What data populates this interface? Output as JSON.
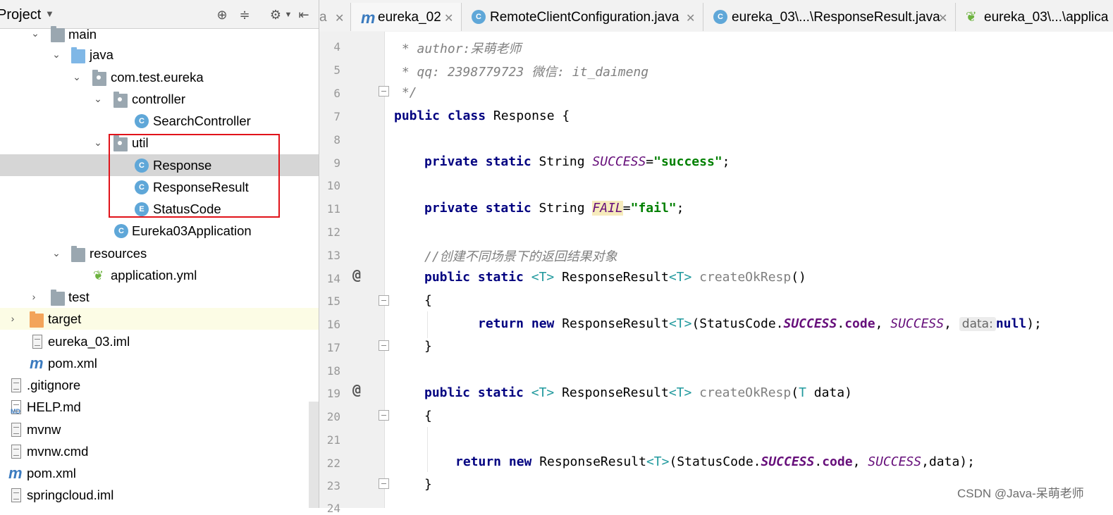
{
  "project_panel": {
    "title": "Project",
    "tree": [
      {
        "label": "main",
        "icon": "folder-icon",
        "indent": 1,
        "expanded": true
      },
      {
        "label": "java",
        "icon": "source-folder-icon",
        "indent": 2,
        "expanded": true
      },
      {
        "label": "com.test.eureka",
        "icon": "package-icon",
        "indent": 3,
        "expanded": true
      },
      {
        "label": "controller",
        "icon": "package-icon",
        "indent": 4,
        "expanded": true
      },
      {
        "label": "SearchController",
        "icon": "class-icon",
        "indent": 5
      },
      {
        "label": "util",
        "icon": "package-icon",
        "indent": 4,
        "expanded": true
      },
      {
        "label": "Response",
        "icon": "class-icon",
        "indent": 5,
        "selected": true
      },
      {
        "label": "ResponseResult",
        "icon": "class-icon",
        "indent": 5
      },
      {
        "label": "StatusCode",
        "icon": "enum-icon",
        "indent": 5
      },
      {
        "label": "Eureka03Application",
        "icon": "spring-boot-class-icon",
        "indent": 4
      },
      {
        "label": "resources",
        "icon": "resources-folder-icon",
        "indent": 2,
        "expanded": true
      },
      {
        "label": "application.yml",
        "icon": "spring-yml-icon",
        "indent": 3
      },
      {
        "label": "test",
        "icon": "folder-icon",
        "indent": 1,
        "expanded": false
      },
      {
        "label": "target",
        "icon": "excluded-folder-icon",
        "indent": 0,
        "expanded": false
      },
      {
        "label": "eureka_03.iml",
        "icon": "iml-file-icon",
        "indent": 1
      },
      {
        "label": "pom.xml",
        "icon": "maven-icon",
        "indent": 1
      },
      {
        "label": ".gitignore",
        "icon": "text-file-icon",
        "indent": 0
      },
      {
        "label": "HELP.md",
        "icon": "markdown-icon",
        "indent": 0
      },
      {
        "label": "mvnw",
        "icon": "text-file-icon",
        "indent": 0
      },
      {
        "label": "mvnw.cmd",
        "icon": "text-file-icon",
        "indent": 0
      },
      {
        "label": "pom.xml",
        "icon": "maven-icon",
        "indent": 0
      },
      {
        "label": "springcloud.iml",
        "icon": "iml-file-icon",
        "indent": 0
      }
    ]
  },
  "tabs": [
    {
      "label": "a"
    },
    {
      "label": "eureka_02",
      "icon": "maven-icon"
    },
    {
      "label": "RemoteClientConfiguration.java",
      "icon": "class-icon"
    },
    {
      "label": "eureka_03\\...\\ResponseResult.java",
      "icon": "class-icon"
    },
    {
      "label": "eureka_03\\...\\applica",
      "icon": "spring-yml-icon"
    }
  ],
  "editor": {
    "line_numbers": [
      "4",
      "5",
      "6",
      "7",
      "8",
      "9",
      "10",
      "11",
      "12",
      "13",
      "14",
      "15",
      "16",
      "17",
      "18",
      "19",
      "20",
      "21",
      "22",
      "23",
      "24"
    ],
    "lines": {
      "l4": " * author:呆萌老师",
      "l5": " * qq: 2398779723 微信: it_daimeng",
      "l6": " */",
      "l7_kw": "public class",
      "l7_rest": " Response {",
      "l9_kw": "private static",
      "l9_type": " String ",
      "l9_const": "SUCCESS",
      "l9_eq": "=",
      "l9_str": "\"success\"",
      "l9_end": ";",
      "l11_kw": "private static",
      "l11_type": " String ",
      "l11_const": "FAIL",
      "l11_eq": "=",
      "l11_str": "\"fail\"",
      "l11_end": ";",
      "l13": "//创建不同场景下的返回结果对象",
      "l14_kw": "public static",
      "l14_gen": "<T>",
      "l14_type": " ResponseResult",
      "l14_gen2": "<T>",
      "l14_method": " createOkResp",
      "l14_end": "()",
      "l15": "{",
      "l16_kw": "return new",
      "l16_type": " ResponseResult",
      "l16_gen": "<T>",
      "l16_open": "(StatusCode.",
      "l16_c1": "SUCCESS",
      "l16_dot": ".",
      "l16_code": "code",
      "l16_comma": ", ",
      "l16_c2": "SUCCESS",
      "l16_comma2": ", ",
      "l16_hint": "data:",
      "l16_null": "null",
      "l16_end": ");",
      "l17": "}",
      "l19_kw": "public static",
      "l19_gen": "<T>",
      "l19_type": " ResponseResult",
      "l19_gen2": "<T>",
      "l19_method": " createOkResp",
      "l19_open": "(",
      "l19_T": "T",
      "l19_end": " data)",
      "l20": "{",
      "l22_kw": "return new",
      "l22_type": " ResponseResult",
      "l22_gen": "<T>",
      "l22_open": "(StatusCode.",
      "l22_c1": "SUCCESS",
      "l22_dot": ".",
      "l22_code": "code",
      "l22_comma": ", ",
      "l22_c2": "SUCCESS",
      "l22_end": ",data);",
      "l23": "}"
    }
  },
  "watermark": "CSDN @Java-呆萌老师"
}
